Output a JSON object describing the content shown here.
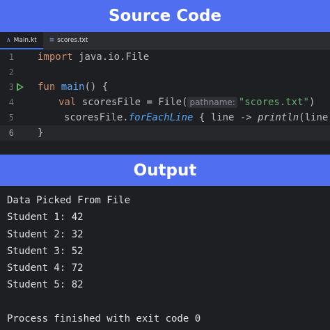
{
  "banners": {
    "top": "Source Code",
    "middle": "Output"
  },
  "tabs": [
    {
      "label": "Main.kt",
      "icon": "kotlin-file-icon",
      "active": true
    },
    {
      "label": "scores.txt",
      "icon": "text-file-icon",
      "active": false
    }
  ],
  "editor": {
    "line_numbers": [
      "1",
      "2",
      "3",
      "4",
      "5",
      "6"
    ],
    "line1": {
      "kw": "import",
      "rest": " java.io.File"
    },
    "line3": {
      "kw": "fun",
      "space": " ",
      "name": "main",
      "rest": "() {"
    },
    "line4": {
      "kw": "val",
      "rest": " scoresFile = File(",
      "hint": "pathname:",
      "str": "\"scores.txt\"",
      "close": ")"
    },
    "line5": {
      "pre": "scoresFile.",
      "ext": "forEachLine",
      "mid": " { line -> ",
      "std": "println",
      "post": "(line) }"
    },
    "line6": {
      "text": "}"
    }
  },
  "output": {
    "lines": [
      "Data Picked From File",
      "Student 1: 42",
      "Student 2: 32",
      "Student 3: 52",
      "Student 4: 72",
      "Student 5: 82",
      "",
      "Process finished with exit code 0"
    ]
  },
  "colors": {
    "banner": "#4f6ff0",
    "background": "#1e1f22",
    "keyword": "#cf8e6d",
    "function": "#56a8f5",
    "string": "#6aab73",
    "run_icon": "#5fb865"
  }
}
